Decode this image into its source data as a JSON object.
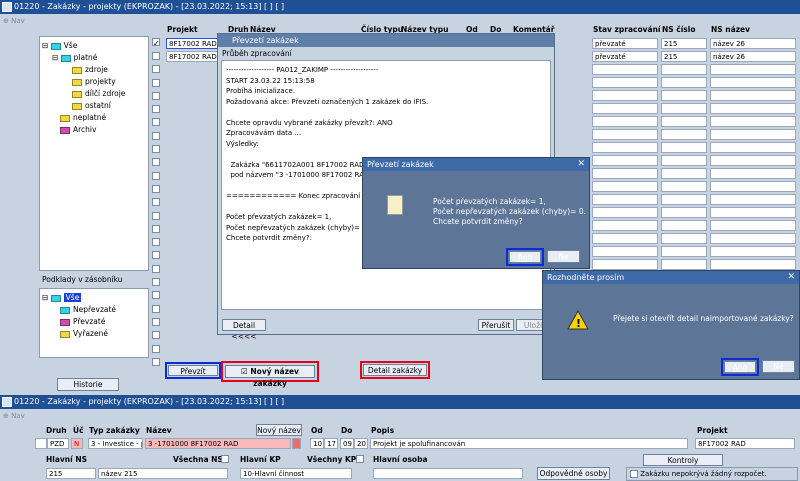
{
  "top_window": {
    "title": "01220 - Zakázky - projekty (EKPROZAK) - [23.03.2022; 15:13] [ ] [ ]",
    "nav": "Nav"
  },
  "tree": {
    "items": [
      {
        "label": "Vše"
      },
      {
        "label": "platné"
      },
      {
        "label": "zdroje"
      },
      {
        "label": "projekty"
      },
      {
        "label": "dílčí zdroje"
      },
      {
        "label": "ostatní"
      },
      {
        "label": "neplatné"
      },
      {
        "label": "Archiv"
      }
    ],
    "podklady_title": "Podklady v zásobníku",
    "podklady": [
      {
        "label": "Vše"
      },
      {
        "label": "Nepřevzaté"
      },
      {
        "label": "Převzaté"
      },
      {
        "label": "Vyřazené"
      }
    ]
  },
  "buttons": {
    "historie": "Historie",
    "prevzit": "Převzít",
    "novy_nazev": "Nový název zakázky",
    "detail_zakazky": "Detail zakázky"
  },
  "grid": {
    "headers": {
      "projekt": "Projekt",
      "druh": "Druh",
      "nazev": "Název",
      "cislo_typu": "Číslo typu",
      "nazev_typu": "Název typu",
      "od": "Od",
      "do": "Do",
      "komentar": "Komentář",
      "stav": "Stav zpracování",
      "ns_cislo": "NS číslo",
      "ns_nazev": "NS název"
    },
    "rows": [
      {
        "projekt": "8F17002 RAD",
        "stav": "převzaté",
        "ns_cislo": "215",
        "ns_nazev": "název 26"
      },
      {
        "projekt": "8F17002 RAD",
        "stav": "převzaté",
        "ns_cislo": "215",
        "ns_nazev": "název 26"
      }
    ]
  },
  "progress_dialog": {
    "title": "Převzetí zakázek",
    "subtitle": "Průběh zpracování",
    "log": [
      "------------------- PA012_ZAKIMP -------------------",
      "START 23.03.22 15:13:58",
      "Probíhá inicializace.",
      "Požadovaná akce: Převzetí označených 1 zakázek do iFIS.",
      "",
      "Chcete opravdu vybrané zakázky převzít?: ANO",
      "Zpracovávám data ...",
      "Výsledky:",
      "",
      "  Zakázka \"6611702A001 8F17002 RAD",
      "  pod názvem \"3 -1701000 8F17002 RAD",
      "",
      "============ Konec zpracování ====",
      "",
      "Počet převzatých zakázek= 1,",
      "Počet nepřevzatých zakázek (chyby)= 0",
      "Chcete potvrdit změny?:"
    ],
    "detail_btn": "Detail <<<<",
    "prerusit_btn": "Přerušit",
    "ulozit_btn": "Uloži"
  },
  "confirm_dialog": {
    "title": "Převzetí zakázek",
    "lines": [
      "Počet převzatých zakázek= 1,",
      "Počet nepřevzatých zakázek (chyby)= 0.",
      "Chcete potvrdit změny?"
    ],
    "yes": "Ano",
    "no": "Ne"
  },
  "decide_dialog": {
    "title": "Rozhodněte prosím",
    "message": "Přejete si otevřít detail naimportované zakázky?",
    "yes": "Ano",
    "no": "Ne"
  },
  "bottom_window": {
    "title": "01220 - Zakázky - projekty (EKPROZAK) - [23.03.2022; 15:13] [ ] [ ]",
    "nav": "Nav",
    "labels": {
      "druh": "Druh",
      "uc": "Úč",
      "typ": "Typ zakázky",
      "nazev": "Název",
      "novy_nazev": "Nový název",
      "od": "Od",
      "do": "Do",
      "popis": "Popis",
      "projekt": "Projekt",
      "hlavni_ns": "Hlavní NS",
      "vsechna_ns": "Všechna NS",
      "hlavni_kp": "Hlavní KP",
      "vsechny_kp": "Všechny KP",
      "hlavni_osoba": "Hlavní osoba",
      "kontroly": "Kontroly",
      "odpovedne": "Odpovědné osoby",
      "nepokryva": "Zakázku nepokrývá žádný rozpočet."
    },
    "values": {
      "druh": "PZD",
      "uc": "N",
      "typ": "3 - Investice - p",
      "nazev": "3 -1701000 8F17002 RAD",
      "od": "10",
      "od2": "17",
      "do": "09",
      "do2": "20",
      "popis": "Projekt je spolufinancován",
      "projekt": "8F17002 RAD",
      "hlavni_ns": "215",
      "hlavni_ns_nazev": "název 215",
      "hlavni_kp": "10-Hlavní činnost"
    }
  }
}
